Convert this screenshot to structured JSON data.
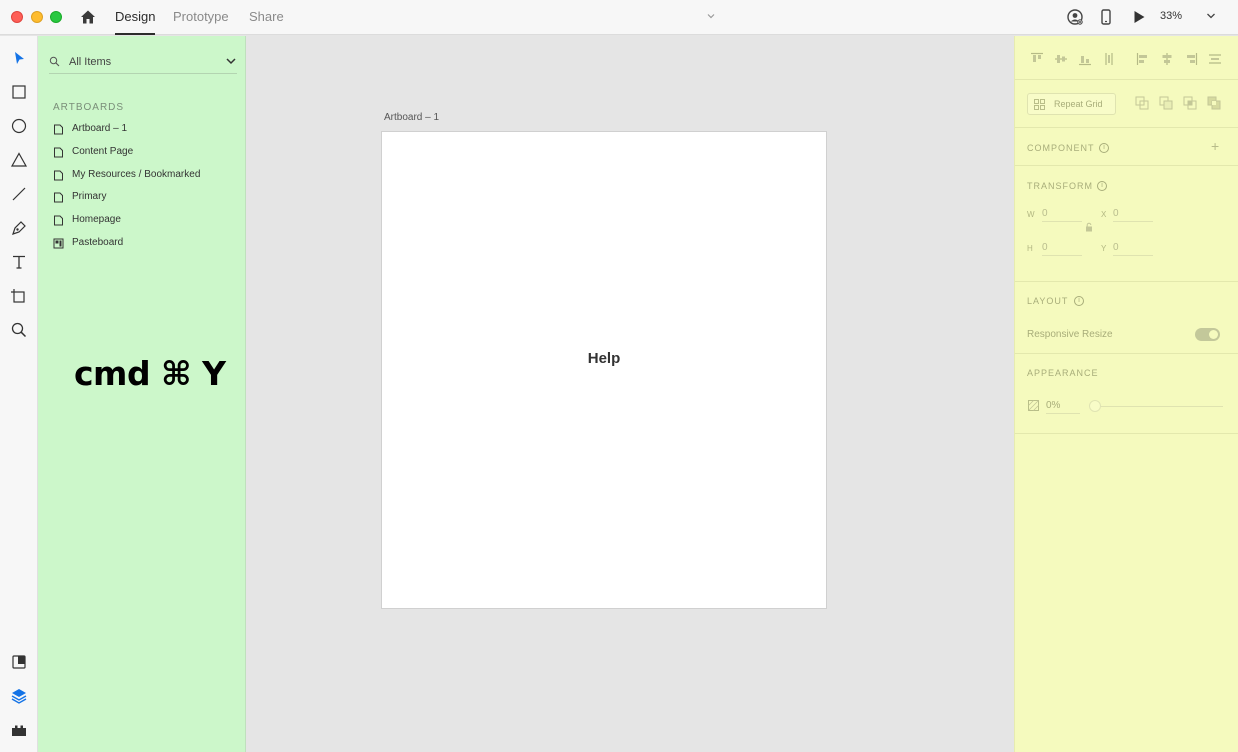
{
  "titlebar": {
    "tabs": [
      {
        "label": "Design",
        "active": true
      },
      {
        "label": "Prototype",
        "active": false
      },
      {
        "label": "Share",
        "active": false
      }
    ],
    "zoom": "33%"
  },
  "layers": {
    "filter_label": "All Items",
    "section_title": "ARTBOARDS",
    "items": [
      {
        "label": "Artboard – 1",
        "icon": "artboard-icon"
      },
      {
        "label": "Content Page",
        "icon": "artboard-icon"
      },
      {
        "label": "My Resources / Bookmarked",
        "icon": "artboard-icon"
      },
      {
        "label": "Primary",
        "icon": "artboard-icon"
      },
      {
        "label": "Homepage",
        "icon": "artboard-icon"
      },
      {
        "label": "Pasteboard",
        "icon": "pasteboard-icon"
      }
    ],
    "shortcut": "cmd ⌘ Y"
  },
  "canvas": {
    "artboard_label": "Artboard – 1",
    "artboard_text": "Help"
  },
  "inspector": {
    "repeat_grid": "Repeat Grid",
    "component": "COMPONENT",
    "transform": "TRANSFORM",
    "w_label": "W",
    "w_value": "0",
    "x_label": "X",
    "x_value": "0",
    "h_label": "H",
    "h_value": "0",
    "y_label": "Y",
    "y_value": "0",
    "layout": "LAYOUT",
    "responsive_resize": "Responsive Resize",
    "appearance": "APPEARANCE",
    "opacity": "0%"
  },
  "colors": {
    "layers_bg": "#ccf7ca",
    "inspector_bg": "#f5fabe",
    "canvas_bg": "#e5e5e5",
    "accent": "#1473e6"
  }
}
